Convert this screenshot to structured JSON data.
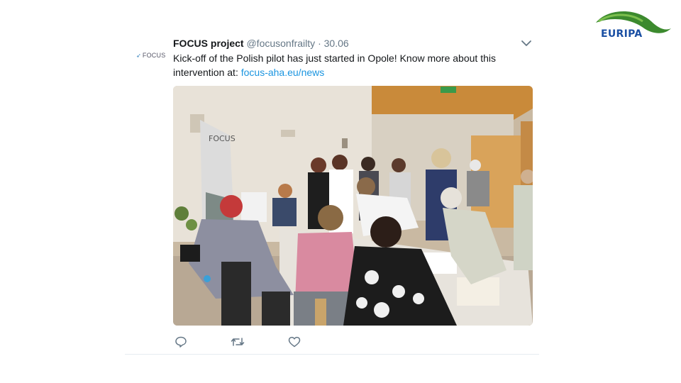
{
  "brand": {
    "logo_text": "EURIPA"
  },
  "tweet": {
    "avatar_text": "FOCUS",
    "author": "FOCUS project",
    "handle": "@focusonfrailty",
    "separator": "·",
    "date": "30.06",
    "text": "Kick-off of the Polish pilot has just started in Opole! Know more about this intervention at: ",
    "link": "focus-aha.eu/news",
    "banner_text": "FOCUS"
  },
  "icons": {
    "avatar": "focus-logo-icon",
    "menu": "chevron-down-icon",
    "reply": "reply-icon",
    "retweet": "retweet-icon",
    "like": "heart-icon"
  },
  "colors": {
    "link": "#1b95e0",
    "icon_gray": "#657786",
    "logo_green": "#3c8a2e",
    "logo_blue": "#1a4fa3"
  }
}
